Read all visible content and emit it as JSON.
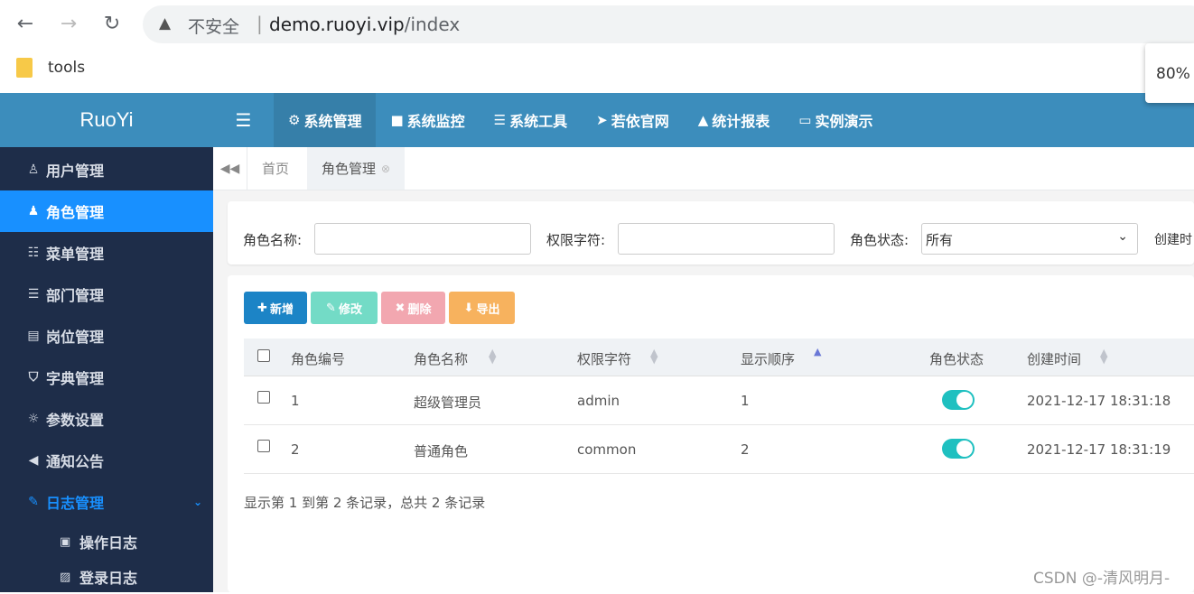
{
  "browser": {
    "security_label": "不安全",
    "separator": "|",
    "url_host": "demo.ruoyi.vip",
    "url_path": "/index",
    "bookmark": "tools",
    "zoom": "80%"
  },
  "app": {
    "logo": "RuoYi"
  },
  "topnav": {
    "items": [
      {
        "icon": "gear-icon",
        "glyph": "⚙",
        "label": "系统管理",
        "active": true
      },
      {
        "icon": "video-icon",
        "glyph": "■",
        "label": "系统监控"
      },
      {
        "icon": "bars-icon",
        "glyph": "☰",
        "label": "系统工具"
      },
      {
        "icon": "location-arrow-icon",
        "glyph": "➤",
        "label": "若依官网"
      },
      {
        "icon": "area-chart-icon",
        "glyph": "▲",
        "label": "统计报表"
      },
      {
        "icon": "desktop-icon",
        "glyph": "▭",
        "label": "实例演示"
      }
    ]
  },
  "sidebar": {
    "items": [
      {
        "icon": "user-icon",
        "glyph": "♙",
        "label": "用户管理"
      },
      {
        "icon": "user-secret-icon",
        "glyph": "♟",
        "label": "角色管理",
        "active": true
      },
      {
        "icon": "th-list-icon",
        "glyph": "☷",
        "label": "菜单管理"
      },
      {
        "icon": "outdent-icon",
        "glyph": "☰",
        "label": "部门管理"
      },
      {
        "icon": "address-card-icon",
        "glyph": "▤",
        "label": "岗位管理"
      },
      {
        "icon": "bookmark-icon",
        "glyph": "⛉",
        "label": "字典管理"
      },
      {
        "icon": "sun-icon",
        "glyph": "☼",
        "label": "参数设置"
      },
      {
        "icon": "bullhorn-icon",
        "glyph": "◀",
        "label": "通知公告"
      },
      {
        "icon": "pencil-square-icon",
        "glyph": "✎",
        "label": "日志管理",
        "open": true
      }
    ],
    "subitems": [
      {
        "icon": "address-book-icon",
        "glyph": "▣",
        "label": "操作日志"
      },
      {
        "icon": "file-image-icon",
        "glyph": "▨",
        "label": "登录日志"
      }
    ]
  },
  "tabs": {
    "items": [
      {
        "label": "首页"
      },
      {
        "label": "角色管理",
        "active": true
      }
    ]
  },
  "search": {
    "role_name_label": "角色名称:",
    "role_name_value": "",
    "perm_label": "权限字符:",
    "perm_value": "",
    "status_label": "角色状态:",
    "status_value": "所有",
    "created_label": "创建时"
  },
  "toolbar": {
    "add": "新增",
    "edit": "修改",
    "delete": "删除",
    "export": "导出"
  },
  "table": {
    "columns": [
      "角色编号",
      "角色名称",
      "权限字符",
      "显示顺序",
      "角色状态",
      "创建时间"
    ],
    "rows": [
      {
        "id": "1",
        "name": "超级管理员",
        "key": "admin",
        "sort": "1",
        "status_on": true,
        "created": "2021-12-17 18:31:18"
      },
      {
        "id": "2",
        "name": "普通角色",
        "key": "common",
        "sort": "2",
        "status_on": true,
        "created": "2021-12-17 18:31:19"
      }
    ],
    "pageinfo": "显示第 1 到第 2 条记录，总共 2 条记录"
  },
  "watermark": "CSDN @-清风明月-"
}
